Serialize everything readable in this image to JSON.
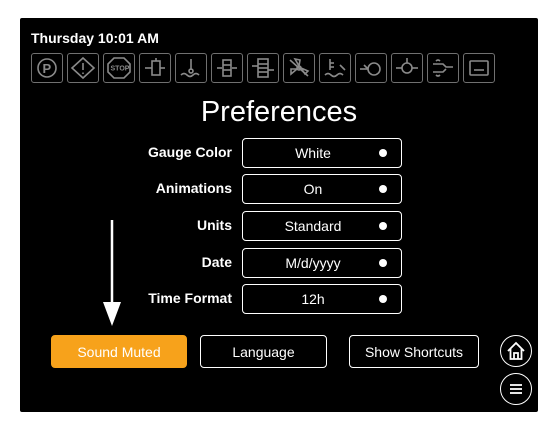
{
  "status": {
    "datetime": "Thursday 10:01 AM"
  },
  "indicators": [
    "parking-brake-icon",
    "warning-icon",
    "stop-icon",
    "fuel-filter-icon",
    "coolant-level-icon",
    "air-filter-icon",
    "hydraulic-filter-icon",
    "fan-icon",
    "engine-oil-icon",
    "hydraulic-oil-icon",
    "transmission-oil-icon",
    "glow-plug-icon",
    "wrench-service-icon"
  ],
  "page": {
    "title": "Preferences"
  },
  "settings": [
    {
      "label": "Gauge Color",
      "value": "White"
    },
    {
      "label": "Animations",
      "value": "On"
    },
    {
      "label": "Units",
      "value": "Standard"
    },
    {
      "label": "Date",
      "value": "M/d/yyyy"
    },
    {
      "label": "Time Format",
      "value": "12h"
    }
  ],
  "buttons": {
    "sound": "Sound Muted",
    "language": "Language",
    "shortcuts": "Show Shortcuts"
  },
  "colors": {
    "accent": "#f7a21b",
    "background": "#000000",
    "foreground": "#ffffff"
  }
}
